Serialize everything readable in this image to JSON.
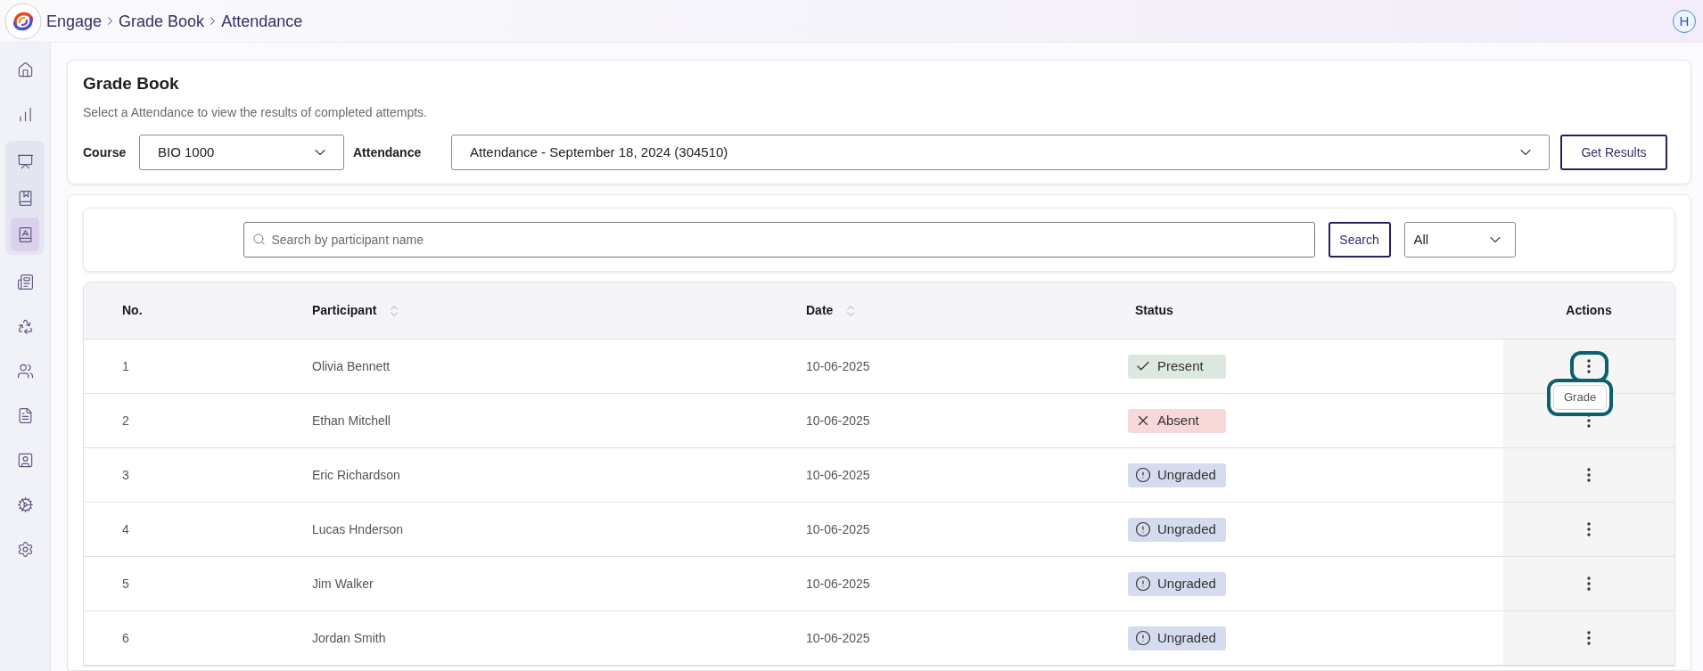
{
  "header": {
    "breadcrumb": [
      "Engage",
      "Grade Book",
      "Attendance"
    ],
    "avatar": "H"
  },
  "sidebar": {
    "items": [
      {
        "kind": "home",
        "selected": false
      },
      {
        "kind": "chart",
        "selected": false
      },
      {
        "kind": "group",
        "items": [
          {
            "kind": "grades",
            "selected": false
          },
          {
            "kind": "gradebook",
            "selected": false
          },
          {
            "kind": "attendance",
            "selected": true
          }
        ]
      },
      {
        "kind": "report",
        "selected": false
      },
      {
        "kind": "recycle",
        "selected": false
      },
      {
        "kind": "users",
        "selected": false
      },
      {
        "kind": "list",
        "selected": false
      },
      {
        "kind": "contact",
        "selected": false
      },
      {
        "kind": "cogs",
        "selected": false
      },
      {
        "kind": "settings",
        "selected": false
      }
    ]
  },
  "filter_card": {
    "title": "Grade Book",
    "subtitle": "Select a Attendance to view the results of completed attempts.",
    "course": {
      "label": "Course",
      "value": "BIO 1000"
    },
    "attendance": {
      "label": "Attendance",
      "value": "Attendance - September 18, 2024 (304510)"
    },
    "submit": "Get Results"
  },
  "search": {
    "placeholder": "Search by participant name",
    "button": "Search",
    "status_filter": "All"
  },
  "table": {
    "columns": [
      {
        "label": "No.",
        "sortable": false
      },
      {
        "label": "Participant",
        "sortable": true
      },
      {
        "label": "Date",
        "sortable": true
      },
      {
        "label": "Status",
        "sortable": false
      },
      {
        "label": "Actions",
        "sortable": false
      }
    ],
    "rows": [
      {
        "no": "1",
        "participant": "Olivia Bennett",
        "date": "10-06-2025",
        "status": {
          "kind": "present",
          "label": "Present",
          "color": "#dde8e1"
        },
        "action_highlighted": true,
        "tooltip": {
          "text": "Grade",
          "highlighted": true
        }
      },
      {
        "no": "2",
        "participant": "Ethan Mitchell",
        "date": "10-06-2025",
        "status": {
          "kind": "absent",
          "label": "Absent",
          "color": "#f6d8d8"
        },
        "action_highlighted": false
      },
      {
        "no": "3",
        "participant": "Eric Richardson",
        "date": "10-06-2025",
        "status": {
          "kind": "ungraded",
          "label": "Ungraded",
          "color": "#d5dcef"
        },
        "action_highlighted": false
      },
      {
        "no": "4",
        "participant": "Lucas Hnderson",
        "date": "10-06-2025",
        "status": {
          "kind": "ungraded",
          "label": "Ungraded",
          "color": "#d5dcef"
        },
        "action_highlighted": false
      },
      {
        "no": "5",
        "participant": "Jim Walker",
        "date": "10-06-2025",
        "status": {
          "kind": "ungraded",
          "label": "Ungraded",
          "color": "#d5dcef"
        },
        "action_highlighted": false
      },
      {
        "no": "6",
        "participant": "Jordan Smith",
        "date": "10-06-2025",
        "status": {
          "kind": "ungraded",
          "label": "Ungraded",
          "color": "#d5dcef"
        },
        "action_highlighted": false
      }
    ]
  }
}
